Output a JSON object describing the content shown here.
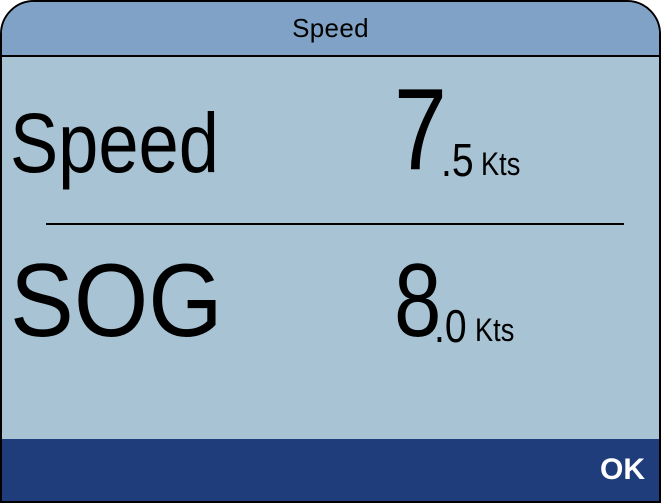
{
  "title": "Speed",
  "rows": [
    {
      "label": "Speed",
      "int": "7",
      "frac": ".5",
      "unit": "Kts"
    },
    {
      "label": "SOG",
      "int": "8",
      "frac": ".0",
      "unit": "Kts"
    }
  ],
  "footer": {
    "ok_label": "OK"
  },
  "colors": {
    "titlebar": "#7fa2c6",
    "body": "#a8c3d4",
    "footer": "#1f3d7a",
    "footer_text": "#ffffff"
  }
}
